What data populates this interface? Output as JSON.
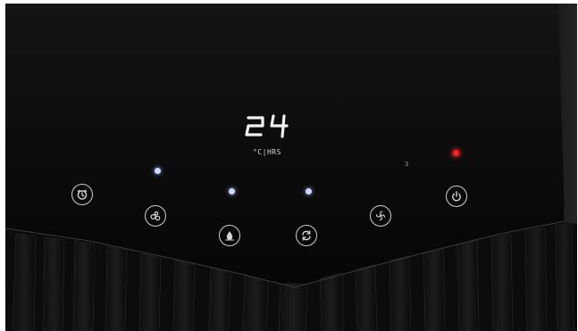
{
  "display": {
    "temperature": "24",
    "unit_label": "°C|HRS",
    "small_indicator": "3"
  },
  "buttons": [
    {
      "id": "timer",
      "icon": "timer-icon"
    },
    {
      "id": "mode",
      "icon": "mode-bubbles-icon"
    },
    {
      "id": "dehumidify",
      "icon": "water-drop-icon"
    },
    {
      "id": "cycle",
      "icon": "cycle-arrows-icon"
    },
    {
      "id": "fan",
      "icon": "fan-icon"
    },
    {
      "id": "power",
      "icon": "power-icon"
    }
  ],
  "indicator_colors": {
    "mode_led": "#cfd8ff",
    "dehumidify_led": "#cfd8ff",
    "cycle_led": "#cfd8ff",
    "power_led": "#ff2020"
  }
}
